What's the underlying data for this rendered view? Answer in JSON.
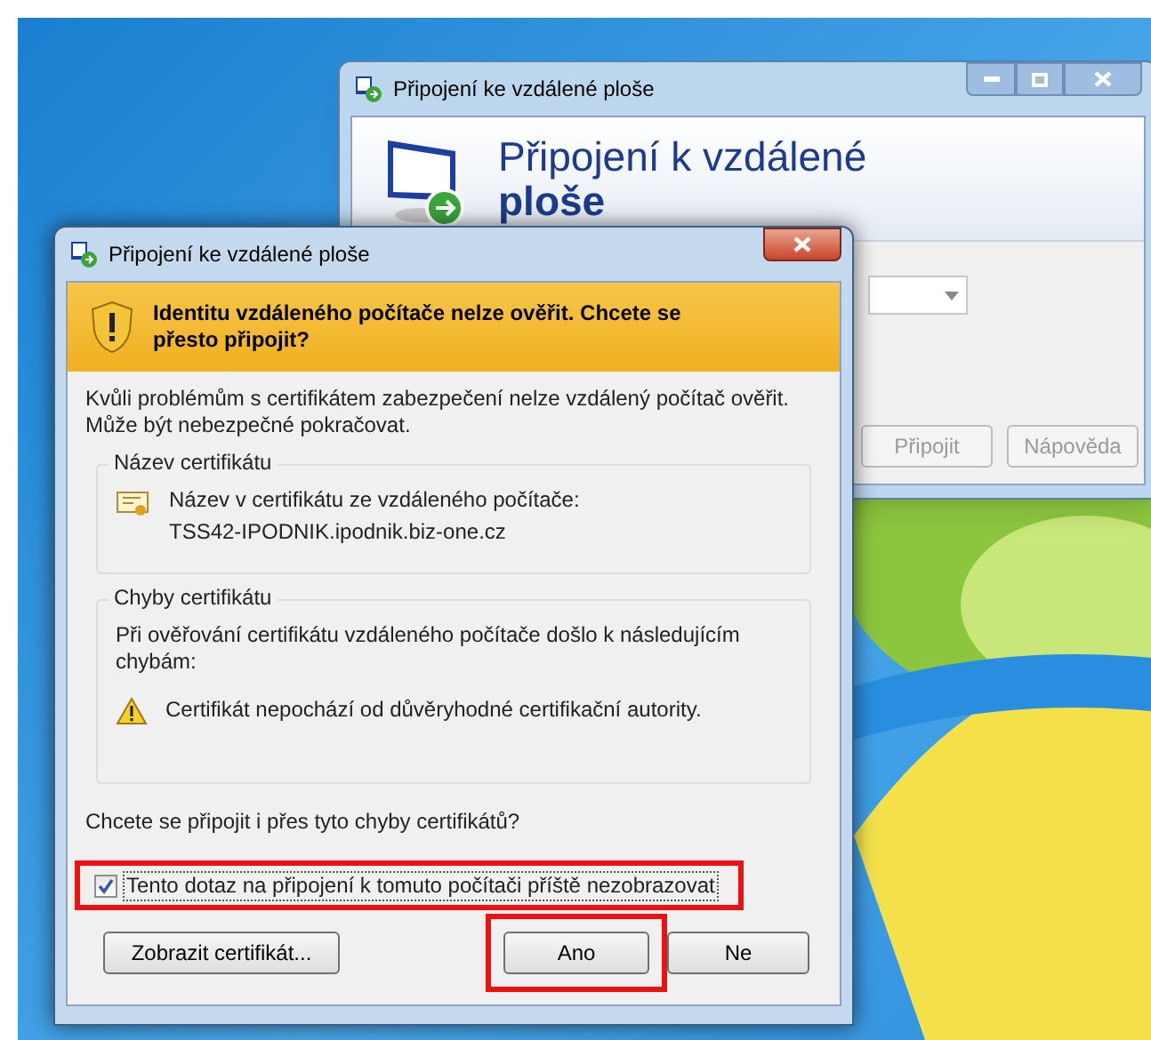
{
  "background_window": {
    "title": "Připojení ke vzdálené ploše",
    "heading_line1": "Připojení k vzdálené",
    "heading_line2": "ploše",
    "buttons": [
      "Připojit",
      "Nápověda"
    ]
  },
  "dialog": {
    "title": "Připojení ke vzdálené ploše",
    "warning": "Identitu vzdáleného počítače nelze ověřit. Chcete se přesto připojit?",
    "intro": "Kvůli problémům s certifikátem zabezpečení nelze vzdálený počítač ověřit. Může být nebezpečné pokračovat.",
    "groups": [
      {
        "title": "Název certifikátu",
        "kind": "certificate",
        "lines": [
          "Název v certifikátu ze vzdáleného počítače:",
          "TSS42-IPODNIK.ipodnik.biz-one.cz"
        ]
      },
      {
        "title": "Chyby certifikátu",
        "kind": "errors",
        "intro": "Při ověřování certifikátu vzdáleného počítače došlo k následujícím chybám:",
        "lines": [
          "Certifikát nepochází od důvěryhodné certifikační autority."
        ]
      }
    ],
    "question": "Chcete se připojit i přes tyto chyby certifikátů?",
    "checkbox": {
      "label": "Tento dotaz na připojení k tomuto počítači příště nezobrazovat",
      "checked": true,
      "highlighted": true
    },
    "buttons": [
      {
        "label": "Zobrazit certifikát...",
        "highlighted": false
      },
      {
        "label": "Ano",
        "highlighted": true
      },
      {
        "label": "Ne",
        "highlighted": false
      }
    ]
  }
}
